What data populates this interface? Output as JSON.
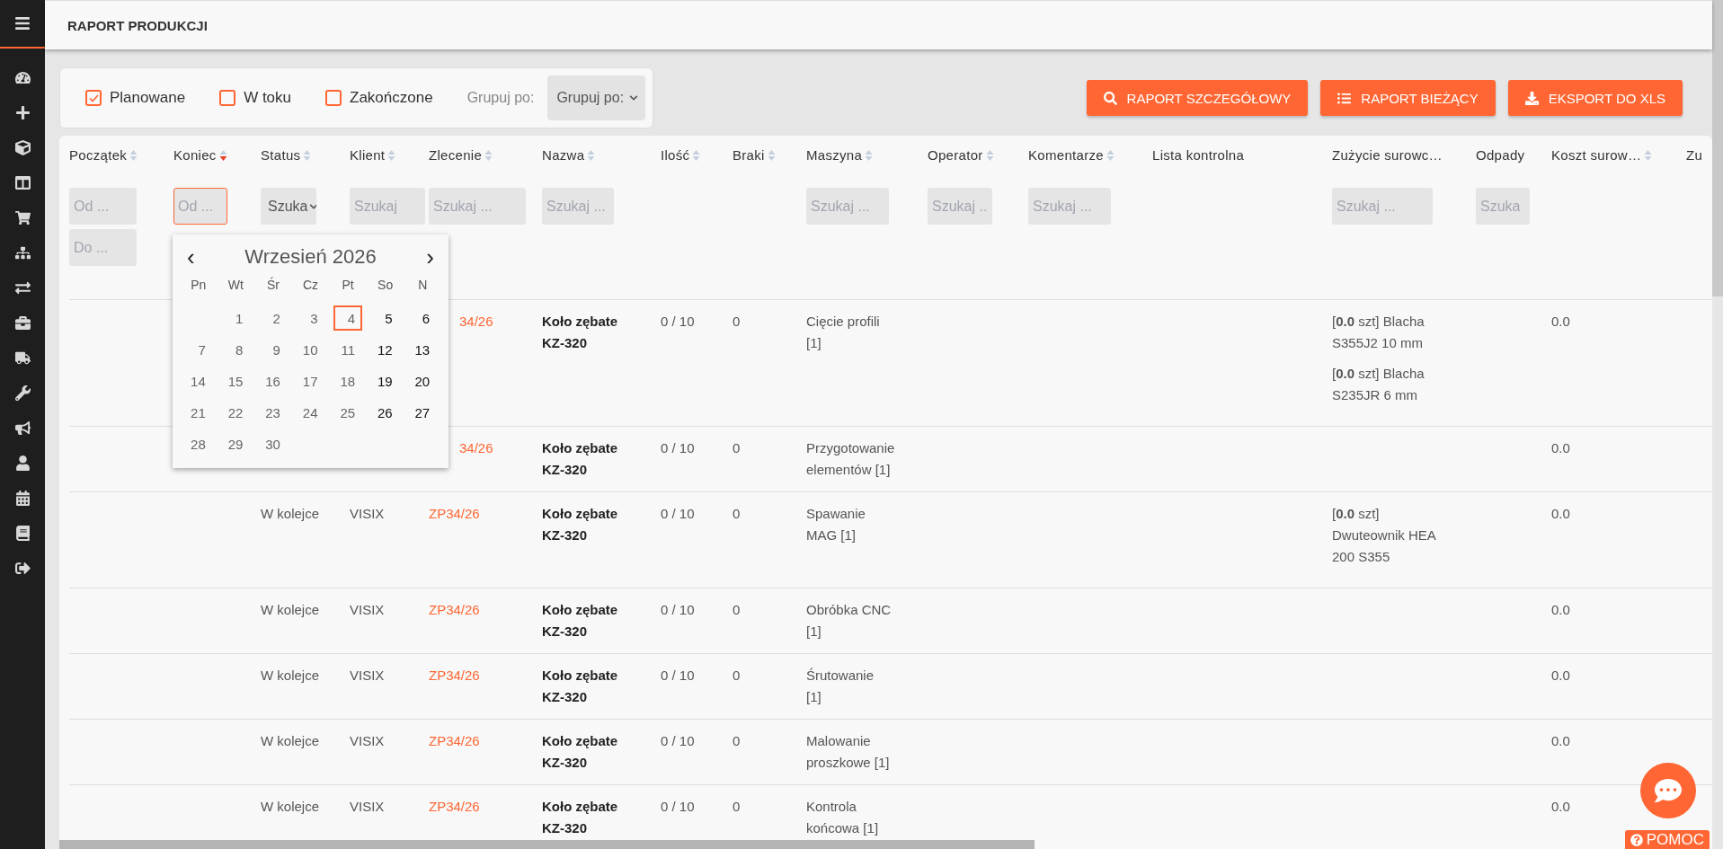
{
  "sidebar": {
    "items": [
      {
        "kind": "dashboard"
      },
      {
        "kind": "plus"
      },
      {
        "kind": "cube"
      },
      {
        "kind": "columns"
      },
      {
        "kind": "cart"
      },
      {
        "kind": "sitemap"
      },
      {
        "kind": "exchange"
      },
      {
        "kind": "briefcase"
      },
      {
        "kind": "truck"
      },
      {
        "kind": "wrench"
      },
      {
        "kind": "bullhorn"
      },
      {
        "kind": "user"
      },
      {
        "kind": "calendar"
      },
      {
        "kind": "book"
      },
      {
        "kind": "signout"
      }
    ]
  },
  "header": {
    "title": "RAPORT PRODUKCJI"
  },
  "filters": {
    "checkboxes": [
      {
        "label": "Planowane",
        "checked": true
      },
      {
        "label": "W toku",
        "checked": false
      },
      {
        "label": "Zakończone",
        "checked": false
      }
    ],
    "group_label": "Grupuj po:",
    "group_select": "Grupuj po:"
  },
  "buttons": [
    {
      "label": "RAPORT SZCZEGÓŁOWY"
    },
    {
      "label": "RAPORT BIEŻĄCY"
    },
    {
      "label": "EKSPORT DO XLS"
    }
  ],
  "table": {
    "columns": [
      {
        "label": "Początek",
        "sortable": true,
        "sort_active": false,
        "filters": [
          {
            "placeholder": "Od ...",
            "focused": false
          },
          {
            "placeholder": "Do ...",
            "focused": false
          }
        ]
      },
      {
        "label": "Koniec",
        "sortable": true,
        "sort_active": true,
        "filters": [
          {
            "placeholder": "Od ...",
            "focused": true
          }
        ]
      },
      {
        "label": "Status",
        "sortable": true,
        "sort_active": false,
        "select": "Szuka"
      },
      {
        "label": "Klient",
        "sortable": true,
        "sort_active": false,
        "filters": [
          {
            "placeholder": "Szukaj",
            "focused": false
          }
        ]
      },
      {
        "label": "Zlecenie",
        "sortable": true,
        "sort_active": false,
        "filters": [
          {
            "placeholder": "Szukaj ...",
            "focused": false
          }
        ]
      },
      {
        "label": "Nazwa",
        "sortable": true,
        "sort_active": false,
        "filters": [
          {
            "placeholder": "Szukaj ...",
            "focused": false
          }
        ]
      },
      {
        "label": "Ilość",
        "sortable": true,
        "sort_active": false
      },
      {
        "label": "Braki",
        "sortable": true,
        "sort_active": false
      },
      {
        "label": "Maszyna",
        "sortable": true,
        "sort_active": false,
        "filters": [
          {
            "placeholder": "Szukaj ...",
            "focused": false
          }
        ]
      },
      {
        "label": "Operator",
        "sortable": true,
        "sort_active": false,
        "filters": [
          {
            "placeholder": "Szukaj ...",
            "focused": false
          }
        ]
      },
      {
        "label": "Komentarze",
        "sortable": true,
        "sort_active": false,
        "filters": [
          {
            "placeholder": "Szukaj ...",
            "focused": false
          }
        ]
      },
      {
        "label": "Lista kontrolna",
        "sortable": false
      },
      {
        "label": "Zużycie surowc…",
        "sortable": false,
        "filters": [
          {
            "placeholder": "Szukaj ...",
            "focused": false
          }
        ]
      },
      {
        "label": "Odpady",
        "sortable": false,
        "filters": [
          {
            "placeholder": "Szuka",
            "focused": false
          }
        ]
      },
      {
        "label": "Koszt surow…",
        "sortable": true,
        "sort_active": false
      },
      {
        "label": "Zu",
        "sortable": false
      }
    ],
    "rows": [
      {
        "zlecenie": "34/26",
        "nazwa": "Koło zębate KZ-320",
        "ilosc": "0 / 10",
        "braki": "0",
        "maszyna": "Cięcie profili [1]",
        "zuzycie": [
          "[**0.0** szt] Blacha S355J2 10 mm",
          "[**0.0** szt] Blacha S235JR 6 mm"
        ],
        "koszt": "0.0"
      },
      {
        "zlecenie": "34/26",
        "nazwa": "Koło zębate KZ-320",
        "ilosc": "0 / 10",
        "braki": "0",
        "maszyna": "Przygotowanie elementów [1]",
        "zuzycie": [],
        "koszt": "0.0"
      },
      {
        "status": "W kolejce",
        "klient": "VISIX",
        "zlecenie": "ZP34/26",
        "nazwa": "Koło zębate KZ-320",
        "ilosc": "0 / 10",
        "braki": "0",
        "maszyna": "Spawanie MAG [1]",
        "zuzycie": [
          "[**0.0** szt] Dwuteownik HEA 200 S355"
        ],
        "koszt": "0.0"
      },
      {
        "status": "W kolejce",
        "klient": "VISIX",
        "zlecenie": "ZP34/26",
        "nazwa": "Koło zębate KZ-320",
        "ilosc": "0 / 10",
        "braki": "0",
        "maszyna": "Obróbka CNC [1]",
        "zuzycie": [],
        "koszt": "0.0"
      },
      {
        "status": "W kolejce",
        "klient": "VISIX",
        "zlecenie": "ZP34/26",
        "nazwa": "Koło zębate KZ-320",
        "ilosc": "0 / 10",
        "braki": "0",
        "maszyna": "Śrutowanie [1]",
        "zuzycie": [],
        "koszt": "0.0"
      },
      {
        "status": "W kolejce",
        "klient": "VISIX",
        "zlecenie": "ZP34/26",
        "nazwa": "Koło zębate KZ-320",
        "ilosc": "0 / 10",
        "braki": "0",
        "maszyna": "Malowanie proszkowe [1]",
        "zuzycie": [],
        "koszt": "0.0"
      },
      {
        "status": "W kolejce",
        "klient": "VISIX",
        "zlecenie": "ZP34/26",
        "nazwa": "Koło zębate KZ-320",
        "ilosc": "0 / 10",
        "braki": "0",
        "maszyna": "Kontrola końcowa [1]",
        "zuzycie": [],
        "koszt": "0.0"
      }
    ]
  },
  "datepicker": {
    "title": "Wrzesień 2026",
    "prev": "‹",
    "next": "›",
    "weekdays": [
      "Pn",
      "Wt",
      "Śr",
      "Cz",
      "Pt",
      "So",
      "N"
    ],
    "weeks": [
      {
        "align_end": true,
        "days": [
          {
            "day": "1",
            "selected": false
          },
          {
            "day": "2",
            "selected": false
          },
          {
            "day": "3",
            "selected": false
          },
          {
            "day": "4",
            "selected": true
          },
          {
            "day": "5",
            "selected": false
          },
          {
            "day": "6",
            "selected": false
          }
        ]
      },
      {
        "days": [
          {
            "day": "7",
            "selected": false
          },
          {
            "day": "8",
            "selected": false
          },
          {
            "day": "9",
            "selected": false
          },
          {
            "day": "10",
            "selected": false
          },
          {
            "day": "11",
            "selected": false
          },
          {
            "day": "12",
            "selected": false
          },
          {
            "day": "13",
            "selected": false
          }
        ]
      },
      {
        "days": [
          {
            "day": "14",
            "selected": false
          },
          {
            "day": "15",
            "selected": false
          },
          {
            "day": "16",
            "selected": false
          },
          {
            "day": "17",
            "selected": false
          },
          {
            "day": "18",
            "selected": false
          },
          {
            "day": "19",
            "selected": false
          },
          {
            "day": "20",
            "selected": false
          }
        ]
      },
      {
        "days": [
          {
            "day": "21",
            "selected": false
          },
          {
            "day": "22",
            "selected": false
          },
          {
            "day": "23",
            "selected": false
          },
          {
            "day": "24",
            "selected": false
          },
          {
            "day": "25",
            "selected": false
          },
          {
            "day": "26",
            "selected": false
          },
          {
            "day": "27",
            "selected": false
          }
        ]
      },
      {
        "align_end": false,
        "days": [
          {
            "day": "28",
            "selected": false
          },
          {
            "day": "29",
            "selected": false
          },
          {
            "day": "30",
            "selected": false
          }
        ]
      }
    ]
  },
  "help": {
    "label": "POMOC"
  }
}
